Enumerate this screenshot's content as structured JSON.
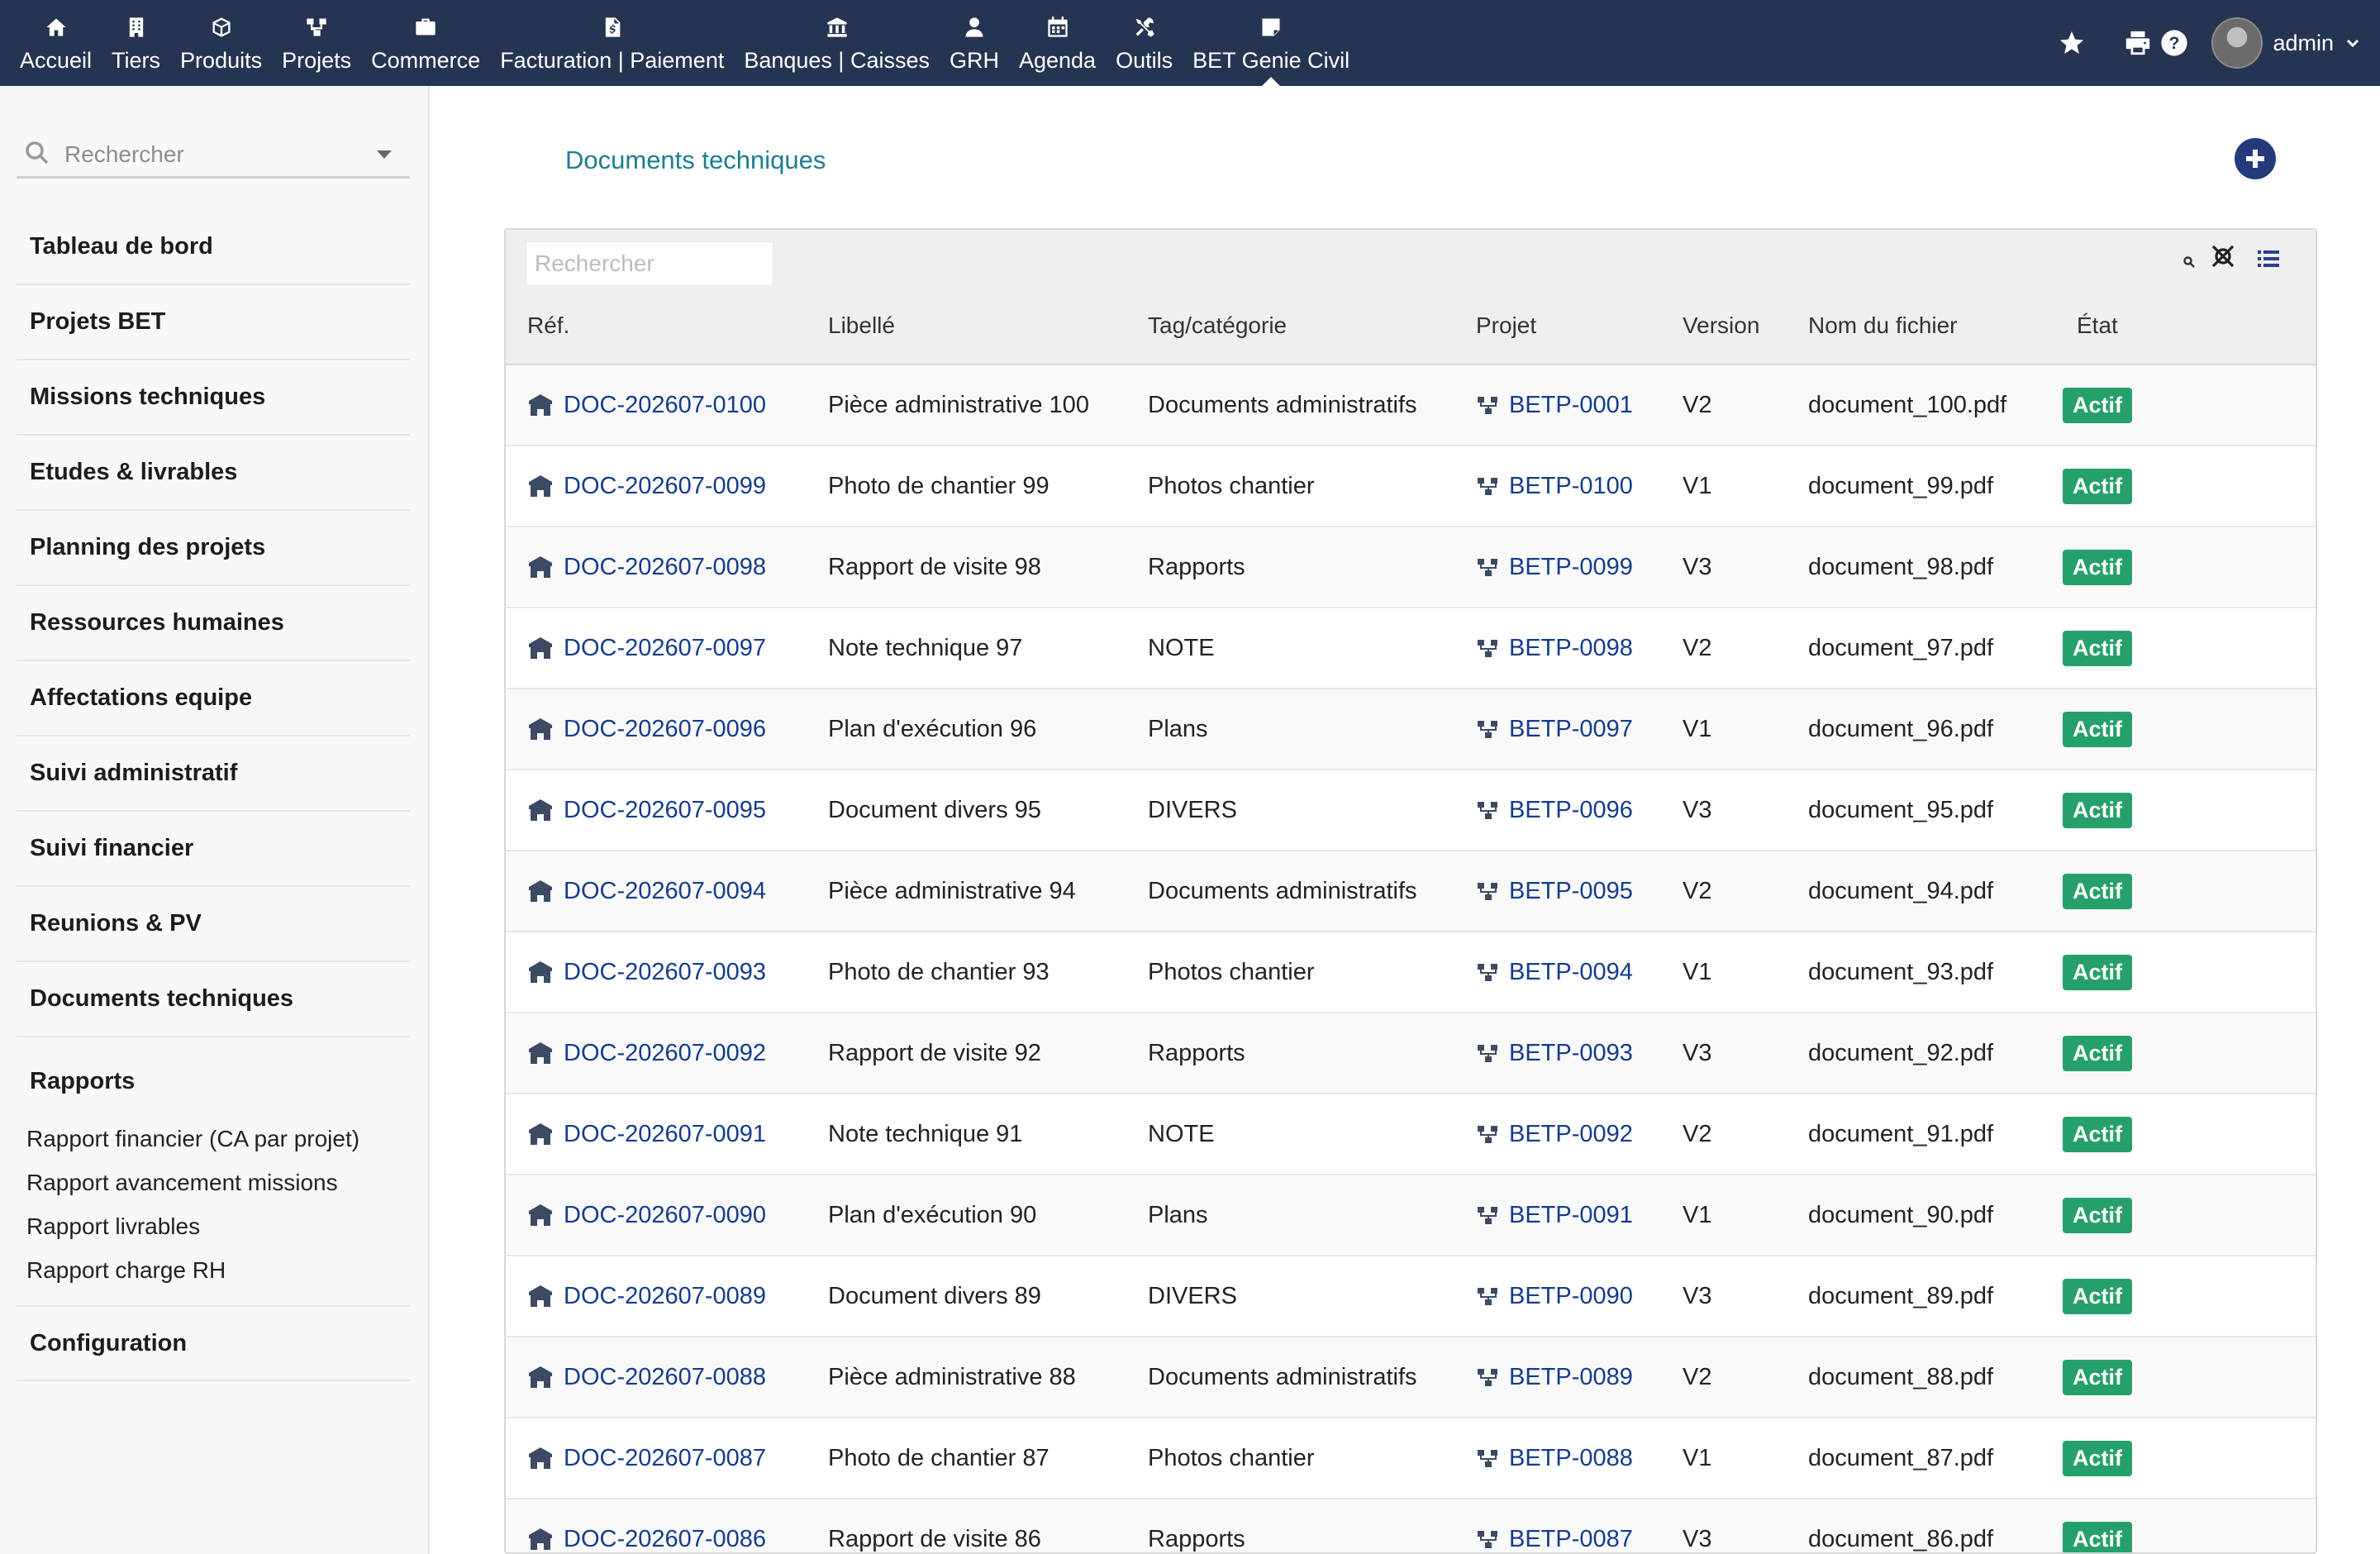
{
  "topnav": {
    "items": [
      {
        "label": "Accueil",
        "icon": "home-icon"
      },
      {
        "label": "Tiers",
        "icon": "building-icon"
      },
      {
        "label": "Produits",
        "icon": "cube-icon"
      },
      {
        "label": "Projets",
        "icon": "project-icon"
      },
      {
        "label": "Commerce",
        "icon": "briefcase-icon"
      },
      {
        "label": "Facturation | Paiement",
        "icon": "invoice-icon"
      },
      {
        "label": "Banques | Caisses",
        "icon": "bank-icon"
      },
      {
        "label": "GRH",
        "icon": "user-tie-icon"
      },
      {
        "label": "Agenda",
        "icon": "calendar-icon"
      },
      {
        "label": "Outils",
        "icon": "tools-icon"
      },
      {
        "label": "BET Genie Civil",
        "icon": "note-icon",
        "active": true
      }
    ],
    "user": "admin"
  },
  "sidebar": {
    "search_placeholder": "Rechercher",
    "items": [
      "Tableau de bord",
      "Projets BET",
      "Missions techniques",
      "Etudes & livrables",
      "Planning des projets",
      "Ressources humaines",
      "Affectations equipe",
      "Suivi administratif",
      "Suivi financier",
      "Reunions & PV",
      "Documents techniques"
    ],
    "reports": {
      "label": "Rapports",
      "items": [
        "Rapport financier (CA par projet)",
        "Rapport avancement missions",
        "Rapport livrables",
        "Rapport charge RH"
      ]
    },
    "config": "Configuration"
  },
  "main": {
    "title": "Documents techniques",
    "filter_placeholder": "Rechercher",
    "columns": [
      "Réf.",
      "Libellé",
      "Tag/catégorie",
      "Projet",
      "Version",
      "Nom du fichier",
      "État"
    ],
    "rows": [
      {
        "ref": "DOC-202607-0100",
        "label": "Pièce administrative 100",
        "tag": "Documents administratifs",
        "project": "BETP-0001",
        "version": "V2",
        "file": "document_100.pdf",
        "status": "Actif"
      },
      {
        "ref": "DOC-202607-0099",
        "label": "Photo de chantier 99",
        "tag": "Photos chantier",
        "project": "BETP-0100",
        "version": "V1",
        "file": "document_99.pdf",
        "status": "Actif"
      },
      {
        "ref": "DOC-202607-0098",
        "label": "Rapport de visite 98",
        "tag": "Rapports",
        "project": "BETP-0099",
        "version": "V3",
        "file": "document_98.pdf",
        "status": "Actif"
      },
      {
        "ref": "DOC-202607-0097",
        "label": "Note technique 97",
        "tag": "NOTE",
        "project": "BETP-0098",
        "version": "V2",
        "file": "document_97.pdf",
        "status": "Actif"
      },
      {
        "ref": "DOC-202607-0096",
        "label": "Plan d'exécution 96",
        "tag": "Plans",
        "project": "BETP-0097",
        "version": "V1",
        "file": "document_96.pdf",
        "status": "Actif"
      },
      {
        "ref": "DOC-202607-0095",
        "label": "Document divers 95",
        "tag": "DIVERS",
        "project": "BETP-0096",
        "version": "V3",
        "file": "document_95.pdf",
        "status": "Actif"
      },
      {
        "ref": "DOC-202607-0094",
        "label": "Pièce administrative 94",
        "tag": "Documents administratifs",
        "project": "BETP-0095",
        "version": "V2",
        "file": "document_94.pdf",
        "status": "Actif"
      },
      {
        "ref": "DOC-202607-0093",
        "label": "Photo de chantier 93",
        "tag": "Photos chantier",
        "project": "BETP-0094",
        "version": "V1",
        "file": "document_93.pdf",
        "status": "Actif"
      },
      {
        "ref": "DOC-202607-0092",
        "label": "Rapport de visite 92",
        "tag": "Rapports",
        "project": "BETP-0093",
        "version": "V3",
        "file": "document_92.pdf",
        "status": "Actif"
      },
      {
        "ref": "DOC-202607-0091",
        "label": "Note technique 91",
        "tag": "NOTE",
        "project": "BETP-0092",
        "version": "V2",
        "file": "document_91.pdf",
        "status": "Actif"
      },
      {
        "ref": "DOC-202607-0090",
        "label": "Plan d'exécution 90",
        "tag": "Plans",
        "project": "BETP-0091",
        "version": "V1",
        "file": "document_90.pdf",
        "status": "Actif"
      },
      {
        "ref": "DOC-202607-0089",
        "label": "Document divers 89",
        "tag": "DIVERS",
        "project": "BETP-0090",
        "version": "V3",
        "file": "document_89.pdf",
        "status": "Actif"
      },
      {
        "ref": "DOC-202607-0088",
        "label": "Pièce administrative 88",
        "tag": "Documents administratifs",
        "project": "BETP-0089",
        "version": "V2",
        "file": "document_88.pdf",
        "status": "Actif"
      },
      {
        "ref": "DOC-202607-0087",
        "label": "Photo de chantier 87",
        "tag": "Photos chantier",
        "project": "BETP-0088",
        "version": "V1",
        "file": "document_87.pdf",
        "status": "Actif"
      },
      {
        "ref": "DOC-202607-0086",
        "label": "Rapport de visite 86",
        "tag": "Rapports",
        "project": "BETP-0087",
        "version": "V3",
        "file": "document_86.pdf",
        "status": "Actif"
      }
    ]
  },
  "colors": {
    "topbar": "#253551",
    "title": "#1b7f8e",
    "link": "#143c8c",
    "badge": "#26a06b",
    "add_button": "#253a7a"
  }
}
